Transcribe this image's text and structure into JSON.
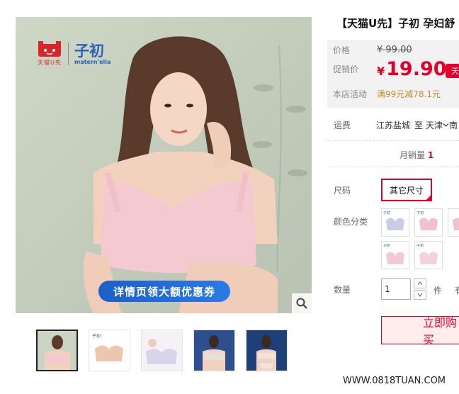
{
  "product": {
    "title": "【天猫U先】子初 孕妇舒",
    "gallery": {
      "brand_logo_tmall_text": "天猫U先",
      "brand_logo_zichu_cn": "子初",
      "brand_logo_zichu_en": "matern'ella",
      "coupon_banner": "详情页领大额优惠券",
      "zoom_icon": "magnifier-icon",
      "thumbnail_count": 5
    },
    "price": {
      "label": "价格",
      "original": "¥ 99.00",
      "promo_label": "促销价",
      "currency": "¥",
      "promo_value": "19.90",
      "promo_tag": "天",
      "activity_label": "本店活动",
      "activity_text": "满99元减78.1元"
    },
    "shipping": {
      "label": "运费",
      "from": "江苏盐城",
      "to_text": "至",
      "destination": "天津",
      "destination_more": "南"
    },
    "sales": {
      "label": "月销量",
      "value": "1"
    },
    "size": {
      "label": "尺码",
      "selected": "其它尺寸"
    },
    "color": {
      "label": "颜色分类"
    },
    "quantity": {
      "label": "数量",
      "value": "1",
      "unit": "件",
      "stock_prefix": "有"
    },
    "buy_button": "立即购买"
  },
  "watermark": "WWW.0818TUAN.COM",
  "colors": {
    "accent_red": "#e4002b",
    "coupon_blue": "#1c5fc9",
    "activity_gold": "#c58a2a"
  }
}
